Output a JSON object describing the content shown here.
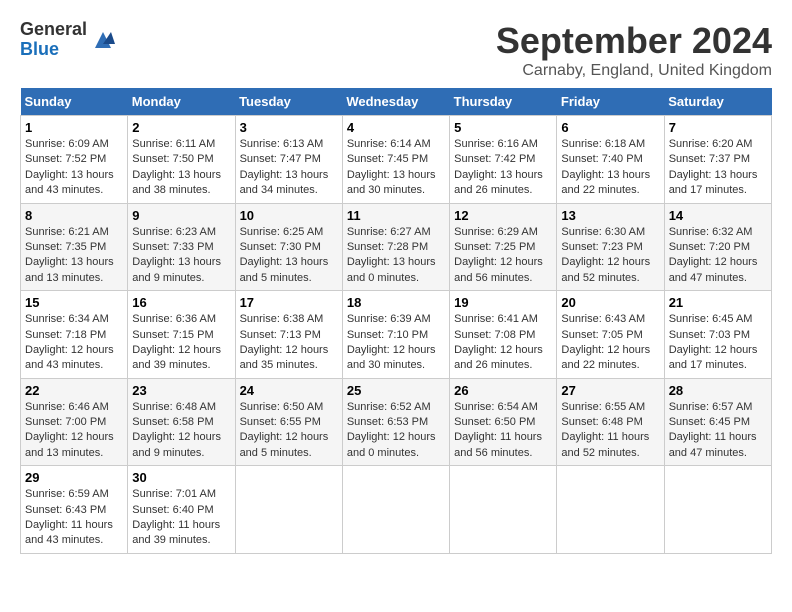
{
  "header": {
    "logo_general": "General",
    "logo_blue": "Blue",
    "title": "September 2024",
    "subtitle": "Carnaby, England, United Kingdom"
  },
  "weekdays": [
    "Sunday",
    "Monday",
    "Tuesday",
    "Wednesday",
    "Thursday",
    "Friday",
    "Saturday"
  ],
  "weeks": [
    [
      {
        "day": "1",
        "sunrise": "6:09 AM",
        "sunset": "7:52 PM",
        "daylight": "13 hours and 43 minutes."
      },
      {
        "day": "2",
        "sunrise": "6:11 AM",
        "sunset": "7:50 PM",
        "daylight": "13 hours and 38 minutes."
      },
      {
        "day": "3",
        "sunrise": "6:13 AM",
        "sunset": "7:47 PM",
        "daylight": "13 hours and 34 minutes."
      },
      {
        "day": "4",
        "sunrise": "6:14 AM",
        "sunset": "7:45 PM",
        "daylight": "13 hours and 30 minutes."
      },
      {
        "day": "5",
        "sunrise": "6:16 AM",
        "sunset": "7:42 PM",
        "daylight": "13 hours and 26 minutes."
      },
      {
        "day": "6",
        "sunrise": "6:18 AM",
        "sunset": "7:40 PM",
        "daylight": "13 hours and 22 minutes."
      },
      {
        "day": "7",
        "sunrise": "6:20 AM",
        "sunset": "7:37 PM",
        "daylight": "13 hours and 17 minutes."
      }
    ],
    [
      {
        "day": "8",
        "sunrise": "6:21 AM",
        "sunset": "7:35 PM",
        "daylight": "13 hours and 13 minutes."
      },
      {
        "day": "9",
        "sunrise": "6:23 AM",
        "sunset": "7:33 PM",
        "daylight": "13 hours and 9 minutes."
      },
      {
        "day": "10",
        "sunrise": "6:25 AM",
        "sunset": "7:30 PM",
        "daylight": "13 hours and 5 minutes."
      },
      {
        "day": "11",
        "sunrise": "6:27 AM",
        "sunset": "7:28 PM",
        "daylight": "13 hours and 0 minutes."
      },
      {
        "day": "12",
        "sunrise": "6:29 AM",
        "sunset": "7:25 PM",
        "daylight": "12 hours and 56 minutes."
      },
      {
        "day": "13",
        "sunrise": "6:30 AM",
        "sunset": "7:23 PM",
        "daylight": "12 hours and 52 minutes."
      },
      {
        "day": "14",
        "sunrise": "6:32 AM",
        "sunset": "7:20 PM",
        "daylight": "12 hours and 47 minutes."
      }
    ],
    [
      {
        "day": "15",
        "sunrise": "6:34 AM",
        "sunset": "7:18 PM",
        "daylight": "12 hours and 43 minutes."
      },
      {
        "day": "16",
        "sunrise": "6:36 AM",
        "sunset": "7:15 PM",
        "daylight": "12 hours and 39 minutes."
      },
      {
        "day": "17",
        "sunrise": "6:38 AM",
        "sunset": "7:13 PM",
        "daylight": "12 hours and 35 minutes."
      },
      {
        "day": "18",
        "sunrise": "6:39 AM",
        "sunset": "7:10 PM",
        "daylight": "12 hours and 30 minutes."
      },
      {
        "day": "19",
        "sunrise": "6:41 AM",
        "sunset": "7:08 PM",
        "daylight": "12 hours and 26 minutes."
      },
      {
        "day": "20",
        "sunrise": "6:43 AM",
        "sunset": "7:05 PM",
        "daylight": "12 hours and 22 minutes."
      },
      {
        "day": "21",
        "sunrise": "6:45 AM",
        "sunset": "7:03 PM",
        "daylight": "12 hours and 17 minutes."
      }
    ],
    [
      {
        "day": "22",
        "sunrise": "6:46 AM",
        "sunset": "7:00 PM",
        "daylight": "12 hours and 13 minutes."
      },
      {
        "day": "23",
        "sunrise": "6:48 AM",
        "sunset": "6:58 PM",
        "daylight": "12 hours and 9 minutes."
      },
      {
        "day": "24",
        "sunrise": "6:50 AM",
        "sunset": "6:55 PM",
        "daylight": "12 hours and 5 minutes."
      },
      {
        "day": "25",
        "sunrise": "6:52 AM",
        "sunset": "6:53 PM",
        "daylight": "12 hours and 0 minutes."
      },
      {
        "day": "26",
        "sunrise": "6:54 AM",
        "sunset": "6:50 PM",
        "daylight": "11 hours and 56 minutes."
      },
      {
        "day": "27",
        "sunrise": "6:55 AM",
        "sunset": "6:48 PM",
        "daylight": "11 hours and 52 minutes."
      },
      {
        "day": "28",
        "sunrise": "6:57 AM",
        "sunset": "6:45 PM",
        "daylight": "11 hours and 47 minutes."
      }
    ],
    [
      {
        "day": "29",
        "sunrise": "6:59 AM",
        "sunset": "6:43 PM",
        "daylight": "11 hours and 43 minutes."
      },
      {
        "day": "30",
        "sunrise": "7:01 AM",
        "sunset": "6:40 PM",
        "daylight": "11 hours and 39 minutes."
      },
      null,
      null,
      null,
      null,
      null
    ]
  ]
}
